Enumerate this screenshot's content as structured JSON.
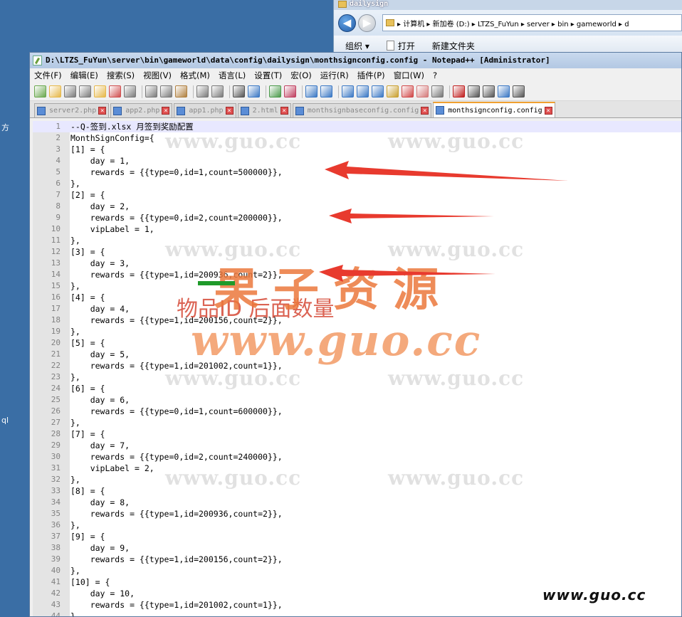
{
  "desktop": {
    "left_texts": [
      "方",
      "ql"
    ]
  },
  "explorer": {
    "title": "dailysign",
    "breadcrumb": "▸ 计算机 ▸ 新加卷 (D:) ▸ LTZS_FuYun ▸ server ▸ bin ▸ gameworld ▸ d",
    "commands": [
      "组织 ▾",
      "打开",
      "新建文件夹"
    ]
  },
  "window": {
    "title": "D:\\LTZS_FuYun\\server\\bin\\gameworld\\data\\config\\dailysign\\monthsignconfig.config - Notepad++ [Administrator]"
  },
  "menu": [
    "文件(F)",
    "编辑(E)",
    "搜索(S)",
    "视图(V)",
    "格式(M)",
    "语言(L)",
    "设置(T)",
    "宏(O)",
    "运行(R)",
    "插件(P)",
    "窗口(W)",
    "?"
  ],
  "tabs": [
    {
      "label": "server2.php",
      "active": false
    },
    {
      "label": "app2.php",
      "active": false
    },
    {
      "label": "app1.php",
      "active": false
    },
    {
      "label": "2.html",
      "active": false
    },
    {
      "label": "monthsignbaseconfig.config",
      "active": false
    },
    {
      "label": "monthsignconfig.config",
      "active": true
    }
  ],
  "editor": {
    "lines": [
      "--Q-签到.xlsx 月签到奖励配置",
      "MonthSignConfig={",
      "[1] = {",
      "    day = 1,",
      "    rewards = {{type=0,id=1,count=500000}},",
      "},",
      "[2] = {",
      "    day = 2,",
      "    rewards = {{type=0,id=2,count=200000}},",
      "    vipLabel = 1,",
      "},",
      "[3] = {",
      "    day = 3,",
      "    rewards = {{type=1,id=200936,count=2}},",
      "},",
      "[4] = {",
      "    day = 4,",
      "    rewards = {{type=1,id=200156,count=2}},",
      "},",
      "[5] = {",
      "    day = 5,",
      "    rewards = {{type=1,id=201002,count=1}},",
      "},",
      "[6] = {",
      "    day = 6,",
      "    rewards = {{type=0,id=1,count=600000}},",
      "},",
      "[7] = {",
      "    day = 7,",
      "    rewards = {{type=0,id=2,count=240000}},",
      "    vipLabel = 2,",
      "},",
      "[8] = {",
      "    day = 8,",
      "    rewards = {{type=1,id=200936,count=2}},",
      "},",
      "[9] = {",
      "    day = 9,",
      "    rewards = {{type=1,id=200156,count=2}},",
      "},",
      "[10] = {",
      "    day = 10,",
      "    rewards = {{type=1,id=201002,count=1}},",
      "},"
    ]
  },
  "watermarks": {
    "small": "www.guo.cc",
    "big_cn": "果子资源",
    "big_url": "www.guo.cc",
    "annotation": "物品ID    后面数量",
    "corner": "www.guo.cc"
  },
  "colors": {
    "arrow": "#e83a2e",
    "accent": "#f0a030"
  }
}
